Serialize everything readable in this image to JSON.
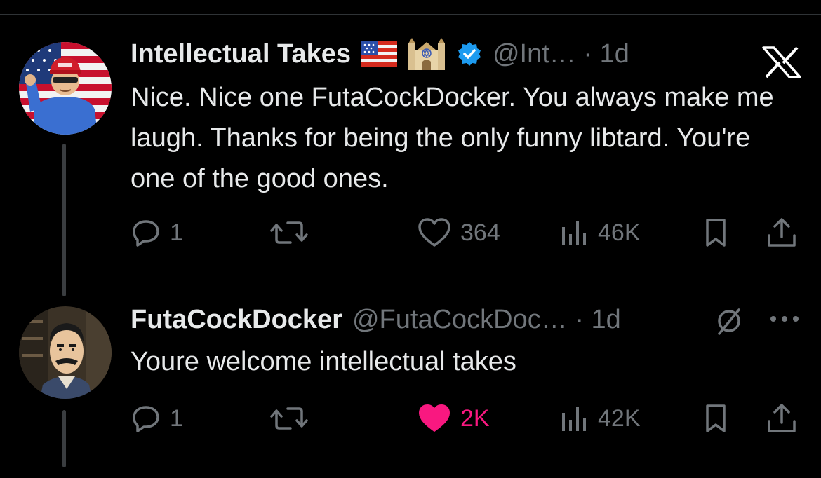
{
  "colors": {
    "background": "#000000",
    "text": "#e7e9ea",
    "muted": "#71767b",
    "verified": "#1d9bf0",
    "like_active": "#f91880",
    "thread_line": "#3a3d40"
  },
  "tweets": [
    {
      "display_name": "Intellectual Takes",
      "badges": [
        "us-flag-emoji",
        "synagogue-emoji",
        "verified-badge-icon"
      ],
      "handle": "@Int…",
      "separator": "·",
      "time": "1d",
      "text": "Nice. Nice one FutaCockDocker. You always make me laugh. Thanks for being the only funny libtard. You're one of the good ones.",
      "replies": "1",
      "retweets": "",
      "likes": "364",
      "liked": false,
      "views": "46K"
    },
    {
      "display_name": "FutaCockDocker",
      "handle": "@FutaCockDoc…",
      "separator": "·",
      "time": "1d",
      "text": "Youre welcome intellectual takes",
      "replies": "1",
      "retweets": "",
      "likes": "2K",
      "liked": true,
      "views": "42K"
    }
  ],
  "icons": {
    "x_logo": "x-logo-icon",
    "no_follow": "slashed-circle-icon",
    "more": "more-horizontal-icon",
    "reply": "reply-icon",
    "retweet": "retweet-icon",
    "like": "heart-icon",
    "views": "views-bar-chart-icon",
    "bookmark": "bookmark-icon",
    "share": "share-icon"
  }
}
